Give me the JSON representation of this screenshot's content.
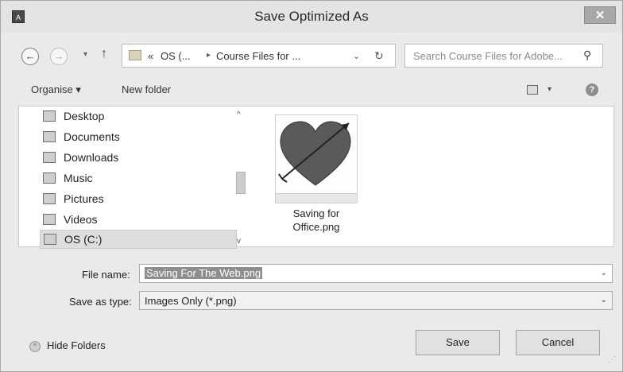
{
  "window": {
    "title": "Save Optimized As",
    "app_icon_text": "A",
    "close_label": "✕"
  },
  "navigation": {
    "back_label": "←",
    "forward_label": "→",
    "up_label": "↑",
    "address_parts": [
      "«",
      "OS (...",
      "Course Files for ..."
    ],
    "search_placeholder": "Search Course Files for Adobe...",
    "refresh_label": "↻",
    "address_drop": "⌄",
    "chevron_down": "▾"
  },
  "toolbar": {
    "organise_label": "Organise ▾",
    "new_folder_label": "New folder",
    "help_label": "?"
  },
  "sidebar": {
    "items": [
      {
        "label": "Desktop",
        "icon": "desktop-icon"
      },
      {
        "label": "Documents",
        "icon": "documents-icon"
      },
      {
        "label": "Downloads",
        "icon": "downloads-icon"
      },
      {
        "label": "Music",
        "icon": "music-icon"
      },
      {
        "label": "Pictures",
        "icon": "pictures-icon"
      },
      {
        "label": "Videos",
        "icon": "videos-icon"
      },
      {
        "label": "OS (C:)",
        "icon": "drive-icon",
        "selected": true
      }
    ],
    "scroll_up": "^",
    "scroll_down": "v"
  },
  "files": [
    {
      "name": "Saving for Office.png",
      "name_line1": "Saving for",
      "name_line2": "Office.png",
      "icon": "heart-arrow-thumbnail"
    }
  ],
  "form": {
    "file_name_label": "File name:",
    "file_name_value": "Saving For The Web.png",
    "save_type_label": "Save as type:",
    "save_type_value": "Images Only (*.png)",
    "drop_glyph": "⌄"
  },
  "footer": {
    "hide_folders_label": "Hide Folders",
    "hide_glyph": "^",
    "save_label": "Save",
    "cancel_label": "Cancel",
    "grip": "⋰"
  }
}
